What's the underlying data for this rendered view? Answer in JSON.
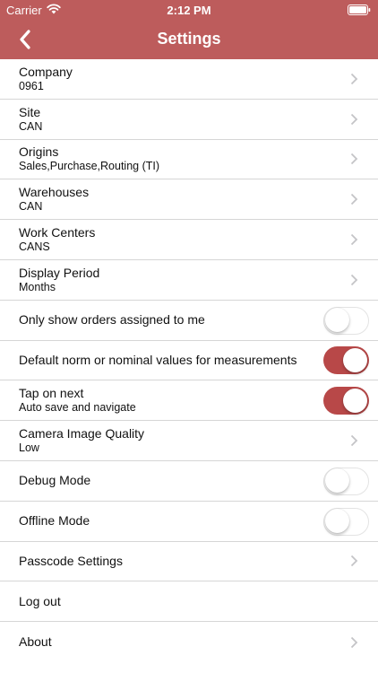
{
  "status_bar": {
    "carrier": "Carrier",
    "time": "2:12 PM"
  },
  "nav": {
    "title": "Settings"
  },
  "colors": {
    "accent": "#bd5c5c",
    "toggle_on": "#b84848"
  },
  "rows": [
    {
      "title": "Company",
      "subtitle": "0961"
    },
    {
      "title": "Site",
      "subtitle": "CAN"
    },
    {
      "title": "Origins",
      "subtitle": "Sales,Purchase,Routing (TI)"
    },
    {
      "title": "Warehouses",
      "subtitle": "CAN"
    },
    {
      "title": "Work Centers",
      "subtitle": "CANS"
    },
    {
      "title": "Display Period",
      "subtitle": "Months"
    },
    {
      "title": "Only show orders assigned to me",
      "toggle": "off"
    },
    {
      "title": "Default norm or nominal values for measurements",
      "toggle": "on"
    },
    {
      "title": "Tap on next",
      "subtitle": "Auto save and navigate",
      "toggle": "on"
    },
    {
      "title": "Camera Image Quality",
      "subtitle": "Low"
    },
    {
      "title": "Debug Mode",
      "toggle": "off"
    },
    {
      "title": "Offline Mode",
      "toggle": "off"
    },
    {
      "title": "Passcode Settings"
    },
    {
      "title": "Log out"
    },
    {
      "title": "About"
    }
  ]
}
